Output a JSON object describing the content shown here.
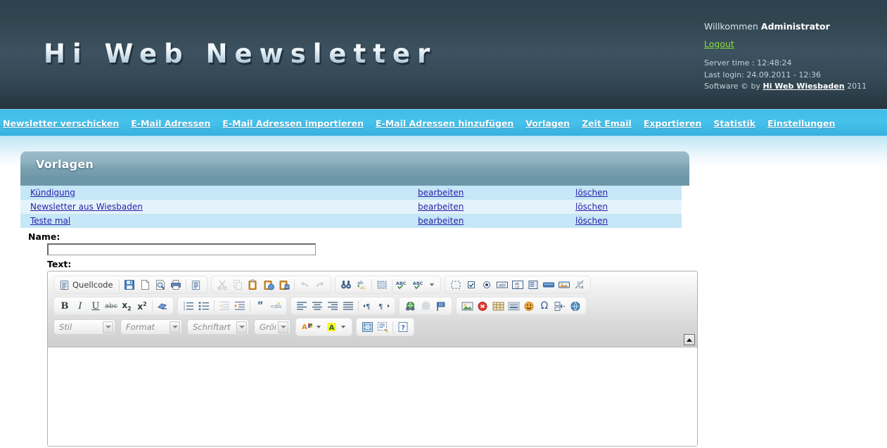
{
  "site": {
    "logo_text": "Hi Web Newsletter"
  },
  "user_panel": {
    "welcome_prefix": "Willkommen ",
    "user_name": "Administrator",
    "logout_label": "Logout",
    "server_time": "Server time : 12:48:24",
    "last_login": "Last login: 24.09.2011 - 12:36",
    "software_prefix": "Software © by ",
    "software_link": "Hi Web Wiesbaden",
    "software_year": " 2011"
  },
  "nav": {
    "items": [
      {
        "label": "Newsletter verschicken",
        "name": "nav-newsletter-verschicken"
      },
      {
        "label": "E-Mail Adressen",
        "name": "nav-email-adressen"
      },
      {
        "label": "E-Mail Adressen importieren",
        "name": "nav-email-adressen-importieren"
      },
      {
        "label": "E-Mail Adressen hinzufügen",
        "name": "nav-email-adressen-hinzufuegen"
      },
      {
        "label": "Vorlagen",
        "name": "nav-vorlagen"
      },
      {
        "label": "Zeit Email",
        "name": "nav-zeit-email"
      },
      {
        "label": "Exportieren",
        "name": "nav-exportieren"
      },
      {
        "label": "Statistik",
        "name": "nav-statistik"
      },
      {
        "label": "Einstellungen",
        "name": "nav-einstellungen"
      }
    ]
  },
  "panel": {
    "title": "Vorlagen"
  },
  "templates": {
    "edit_label": "bearbeiten",
    "delete_label": "löschen",
    "rows": [
      {
        "name": "Kündigung"
      },
      {
        "name": "Newsletter aus Wiesbaden"
      },
      {
        "name": "Teste mal"
      }
    ]
  },
  "form": {
    "name_label": "Name:",
    "name_value": "",
    "name_placeholder": "",
    "text_label": "Text:"
  },
  "editor": {
    "row1": {
      "group1": [
        {
          "name": "source-icon",
          "label": "Quellcode"
        },
        {
          "name": "save-icon",
          "label": ""
        },
        {
          "name": "new-page-icon",
          "label": ""
        },
        {
          "name": "preview-icon",
          "label": ""
        },
        {
          "name": "print-icon",
          "label": ""
        },
        {
          "name": "templates-icon",
          "label": ""
        }
      ],
      "group2": [
        {
          "name": "cut-icon"
        },
        {
          "name": "copy-icon"
        },
        {
          "name": "paste-icon"
        },
        {
          "name": "paste-text-icon"
        },
        {
          "name": "paste-from-word-icon"
        },
        {
          "name": "undo-icon"
        },
        {
          "name": "redo-icon"
        }
      ],
      "group3": [
        {
          "name": "find-icon"
        },
        {
          "name": "replace-icon"
        },
        {
          "name": "select-all-icon"
        },
        {
          "name": "spellcheck-icon"
        },
        {
          "name": "spellcheck-options-icon"
        }
      ],
      "group4": [
        {
          "name": "form-icon"
        },
        {
          "name": "checkbox-icon"
        },
        {
          "name": "radio-button-icon"
        },
        {
          "name": "text-field-icon"
        },
        {
          "name": "textarea-icon"
        },
        {
          "name": "select-field-icon"
        },
        {
          "name": "button-icon"
        },
        {
          "name": "image-button-icon"
        },
        {
          "name": "hidden-field-icon"
        }
      ]
    },
    "row2": {
      "group1": [
        {
          "name": "bold-icon",
          "glyph": "B"
        },
        {
          "name": "italic-icon",
          "glyph": "I"
        },
        {
          "name": "underline-icon",
          "glyph": "U"
        },
        {
          "name": "strikethrough-icon",
          "glyph": "abc"
        },
        {
          "name": "subscript-icon",
          "glyph": "x₂"
        },
        {
          "name": "superscript-icon",
          "glyph": "x²"
        },
        {
          "name": "remove-format-icon",
          "glyph": ""
        }
      ],
      "group2": [
        {
          "name": "numbered-list-icon"
        },
        {
          "name": "bulleted-list-icon"
        },
        {
          "name": "decrease-indent-icon"
        },
        {
          "name": "increase-indent-icon"
        },
        {
          "name": "blockquote-icon"
        },
        {
          "name": "create-div-icon"
        }
      ],
      "group3": [
        {
          "name": "align-left-icon"
        },
        {
          "name": "align-center-icon"
        },
        {
          "name": "align-right-icon"
        },
        {
          "name": "justify-icon"
        },
        {
          "name": "text-direction-ltr-icon"
        },
        {
          "name": "text-direction-rtl-icon"
        }
      ],
      "group4": [
        {
          "name": "link-icon"
        },
        {
          "name": "unlink-icon"
        },
        {
          "name": "anchor-icon"
        }
      ],
      "group5": [
        {
          "name": "image-icon"
        },
        {
          "name": "flash-icon"
        },
        {
          "name": "table-icon"
        },
        {
          "name": "horizontal-rule-icon"
        },
        {
          "name": "smiley-icon"
        },
        {
          "name": "special-char-icon",
          "glyph": "Ω"
        },
        {
          "name": "page-break-icon"
        },
        {
          "name": "iframe-icon"
        }
      ]
    },
    "row3": {
      "selects": [
        {
          "name": "style-select",
          "value": "Stil"
        },
        {
          "name": "paragraph-format-select",
          "value": "Format"
        },
        {
          "name": "font-family-select",
          "value": "Schriftart"
        },
        {
          "name": "font-size-select",
          "value": "Größ"
        }
      ],
      "color_buttons": [
        {
          "name": "text-color-button",
          "glyph": "A"
        },
        {
          "name": "background-color-button",
          "glyph": "A"
        }
      ],
      "tools": [
        {
          "name": "maximize-icon"
        },
        {
          "name": "show-blocks-icon"
        },
        {
          "name": "about-help-icon",
          "glyph": "?"
        }
      ]
    },
    "content": ""
  },
  "colors": {
    "header_dark": "#2e4350",
    "nav_blue": "#40bce8",
    "panel_steel": "#6d97a8",
    "row_odd": "#c5e7f7",
    "row_even": "#e4f3fb",
    "link_purple": "#2a1ea8",
    "logout_green": "#8ddc3d"
  }
}
